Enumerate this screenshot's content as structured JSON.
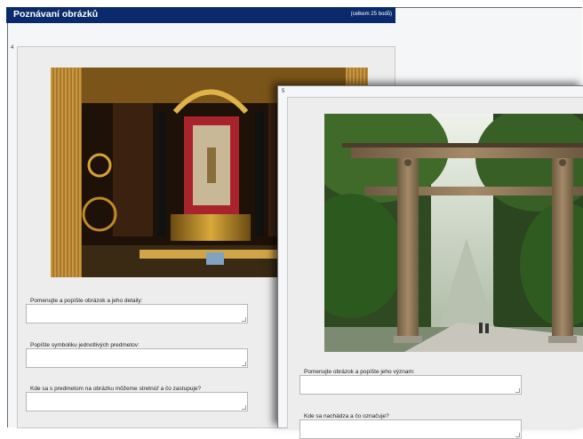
{
  "header": {
    "title": "Poznávaní obrázků",
    "points": "(celkem 25 bodů)"
  },
  "question4": {
    "number": "4",
    "image_alt": "gilded buddhist altar",
    "fields": [
      {
        "label": "Pomenujte a popíšte obrázok a jeho detaily:",
        "value": ""
      },
      {
        "label": "Popíšte symboliku jednotlivých predmetov:",
        "value": ""
      },
      {
        "label": "Kde sa s predmetom na obrázku môžeme stretnúť a čo zastupuje?",
        "value": ""
      }
    ]
  },
  "question5": {
    "number": "5",
    "image_alt": "torii gate in forest",
    "fields": [
      {
        "label": "Pomenujte obrázok a popíšte jeho význam:",
        "value": ""
      },
      {
        "label": "Kde sa nachádza a čo označuje?",
        "value": ""
      }
    ]
  }
}
